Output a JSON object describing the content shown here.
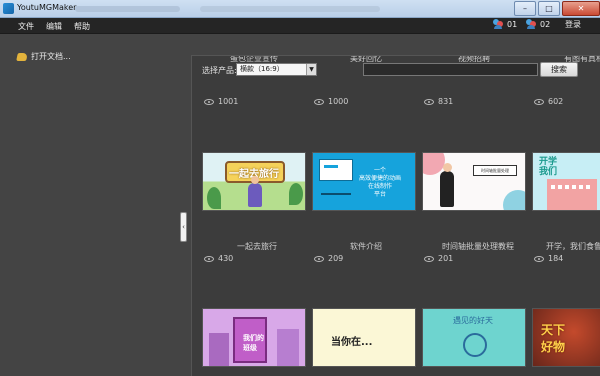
{
  "window": {
    "title": "YoutuMGMaker"
  },
  "menu": {
    "file": "文件",
    "edit": "编辑",
    "help": "帮助"
  },
  "tools": {
    "user1_count": "01",
    "user2_count": "02",
    "login": "登录"
  },
  "left": {
    "open_doc": "打开文档..."
  },
  "filter": {
    "product_label": "选择产品:",
    "product_value": "横款（16:9）",
    "search_placeholder": "",
    "search_button": "搜索"
  },
  "top_row": {
    "titles": [
      "蛋包企业宣传",
      "美好回忆",
      "视频招聘",
      "有图有真相"
    ],
    "views": [
      "1001",
      "1000",
      "831",
      "602"
    ]
  },
  "cards": [
    {
      "title": "一起去旅行",
      "views": "430",
      "thumb_text": "一起去旅行"
    },
    {
      "title": "软件介绍",
      "views": "209",
      "thumb_text": "一个\n高效便捷的动画\n在线制作\n平台"
    },
    {
      "title": "时间轴批量处理教程",
      "views": "201",
      "thumb_text": "时间轴批量处理"
    },
    {
      "title": "开学，我们食鲁",
      "views": "184",
      "thumb_text": "开学\n我们"
    }
  ],
  "bottom_row": {
    "thumb_texts": [
      "我们的\n班级",
      "当你在...",
      "遇见的好天",
      "天下\n好物"
    ]
  },
  "colors": {
    "menubar": "#252525",
    "panel": "#444444",
    "main": "#3c3c3c",
    "accent_blue": "#16a3dc"
  }
}
